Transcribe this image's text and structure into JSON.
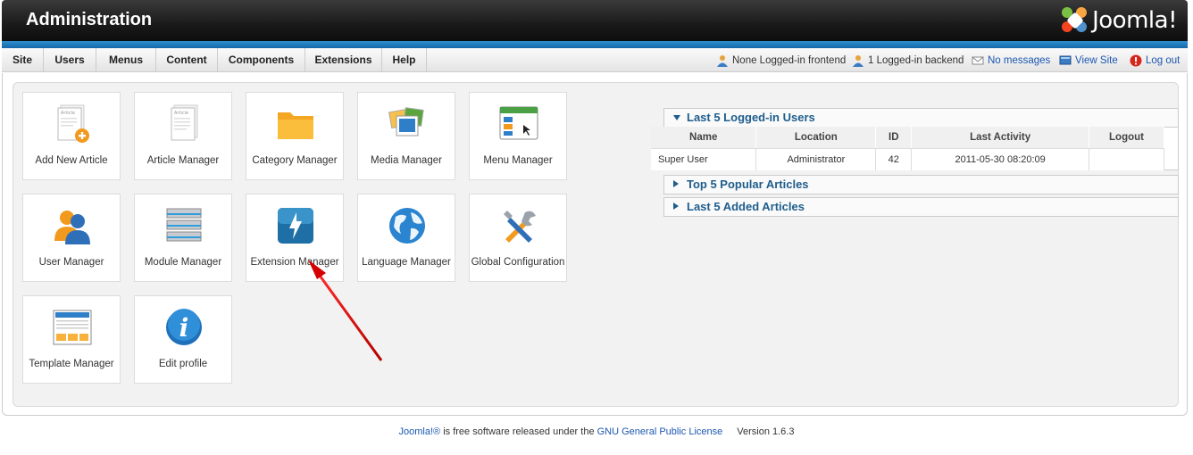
{
  "header": {
    "title": "Administration",
    "logo_text": "Joomla!"
  },
  "menu": {
    "items": [
      "Site",
      "Users",
      "Menus",
      "Content",
      "Components",
      "Extensions",
      "Help"
    ]
  },
  "status": {
    "frontend": "None Logged-in frontend",
    "backend": "1 Logged-in backend",
    "messages": "No messages",
    "view_site": "View Site",
    "logout": "Log out"
  },
  "quickicons": [
    {
      "label": "Add New Article",
      "icon": "add-article-icon"
    },
    {
      "label": "Article Manager",
      "icon": "article-icon"
    },
    {
      "label": "Category Manager",
      "icon": "folder-icon"
    },
    {
      "label": "Media Manager",
      "icon": "media-icon"
    },
    {
      "label": "Menu Manager",
      "icon": "menu-icon"
    },
    {
      "label": "User Manager",
      "icon": "users-icon"
    },
    {
      "label": "Module Manager",
      "icon": "module-icon"
    },
    {
      "label": "Extension Manager",
      "icon": "extension-icon"
    },
    {
      "label": "Language Manager",
      "icon": "globe-icon"
    },
    {
      "label": "Global Configuration",
      "icon": "tools-icon"
    },
    {
      "label": "Template Manager",
      "icon": "template-icon"
    },
    {
      "label": "Edit profile",
      "icon": "info-icon"
    }
  ],
  "modules": {
    "logged_in": {
      "title": "Last 5 Logged-in Users",
      "columns": [
        "Name",
        "Location",
        "ID",
        "Last Activity",
        "Logout"
      ],
      "rows": [
        {
          "name": "Super User",
          "location": "Administrator",
          "id": "42",
          "last_activity": "2011-05-30 08:20:09",
          "logout": ""
        }
      ]
    },
    "popular": {
      "title": "Top 5 Popular Articles"
    },
    "added": {
      "title": "Last 5 Added Articles"
    }
  },
  "footer": {
    "joomla": "Joomla!®",
    "text1": " is free software released under the ",
    "license": "GNU General Public License",
    "version": "Version 1.6.3"
  },
  "colors": {
    "accent": "#1e5d8c",
    "link": "#1b57b1",
    "header": "#1a1a1a",
    "bar": "#2c8fd0"
  }
}
